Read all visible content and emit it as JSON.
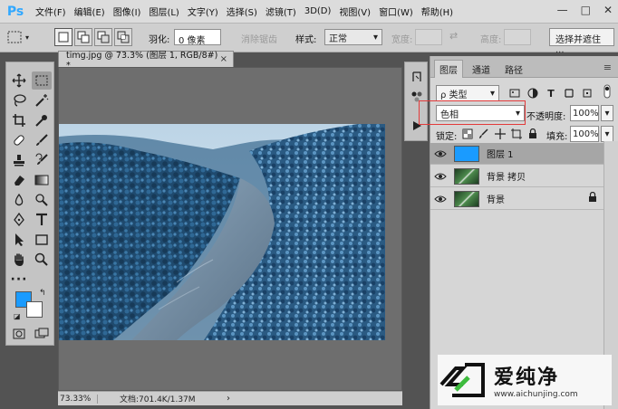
{
  "app": {
    "logo": "Ps",
    "menu": [
      "文件(F)",
      "编辑(E)",
      "图像(I)",
      "图层(L)",
      "文字(Y)",
      "选择(S)",
      "滤镜(T)",
      "3D(D)",
      "视图(V)",
      "窗口(W)",
      "帮助(H)"
    ],
    "window_controls": {
      "minimize": "—",
      "restore": "□",
      "close": "✕"
    }
  },
  "options_bar": {
    "feather_label": "羽化:",
    "feather_value": "0 像素",
    "antialias_label": "消除锯齿",
    "style_label": "样式:",
    "style_value": "正常",
    "width_label": "宽度:",
    "height_label": "高度:",
    "select_mask_button": "选择并遮住 ..."
  },
  "document": {
    "tab_title": "timg.jpg @ 73.3% (图层 1, RGB/8#) *",
    "tab_close": "×",
    "zoom": "73.33%",
    "doc_size": "文档:701.4K/1.37M",
    "status_arrow": "›"
  },
  "layers_panel": {
    "tabs": [
      "图层",
      "通道",
      "路径"
    ],
    "active_tab": 0,
    "filter_kind": "ρ 类型",
    "blend_mode": "色相",
    "opacity_label": "不透明度:",
    "opacity_value": "100%",
    "lock_label": "锁定:",
    "fill_label": "填充:",
    "fill_value": "100%",
    "layers": [
      {
        "name": "图层 1",
        "selected": true,
        "thumb_color": "#1a9bff",
        "locked": false
      },
      {
        "name": "背景 拷贝",
        "selected": false,
        "thumb_color": "#3e7a3e",
        "locked": false
      },
      {
        "name": "背景",
        "selected": false,
        "thumb_color": "#3e7a3e",
        "locked": true
      }
    ]
  },
  "colors": {
    "foreground": "#1a9bff",
    "background": "#ffffff",
    "highlight": "#e23b3b"
  },
  "watermark": {
    "title": "爱纯净",
    "url": "www.aichunjing.com"
  }
}
